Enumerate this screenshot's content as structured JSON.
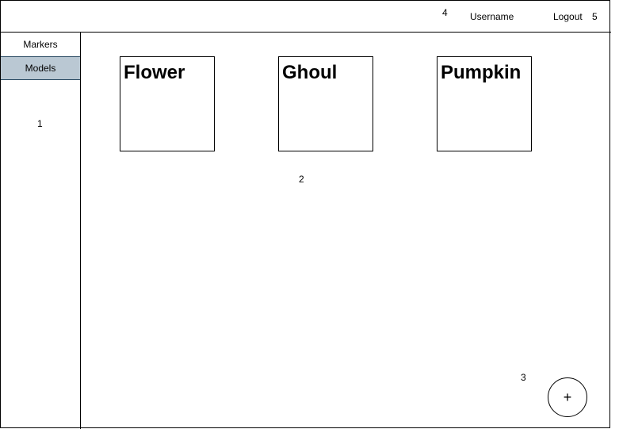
{
  "header": {
    "username": "Username",
    "logout_label": "Logout"
  },
  "sidebar": {
    "items": [
      {
        "label": "Markers",
        "selected": false
      },
      {
        "label": "Models",
        "selected": true
      }
    ],
    "selected_color": "#bac8d3"
  },
  "main": {
    "cards": [
      {
        "title": "Flower"
      },
      {
        "title": "Ghoul"
      },
      {
        "title": "Pumpkin"
      }
    ],
    "add_button_label": "+"
  },
  "annotations": {
    "sidebar": "1",
    "content": "2",
    "add_button": "3",
    "username": "4",
    "logout": "5"
  }
}
